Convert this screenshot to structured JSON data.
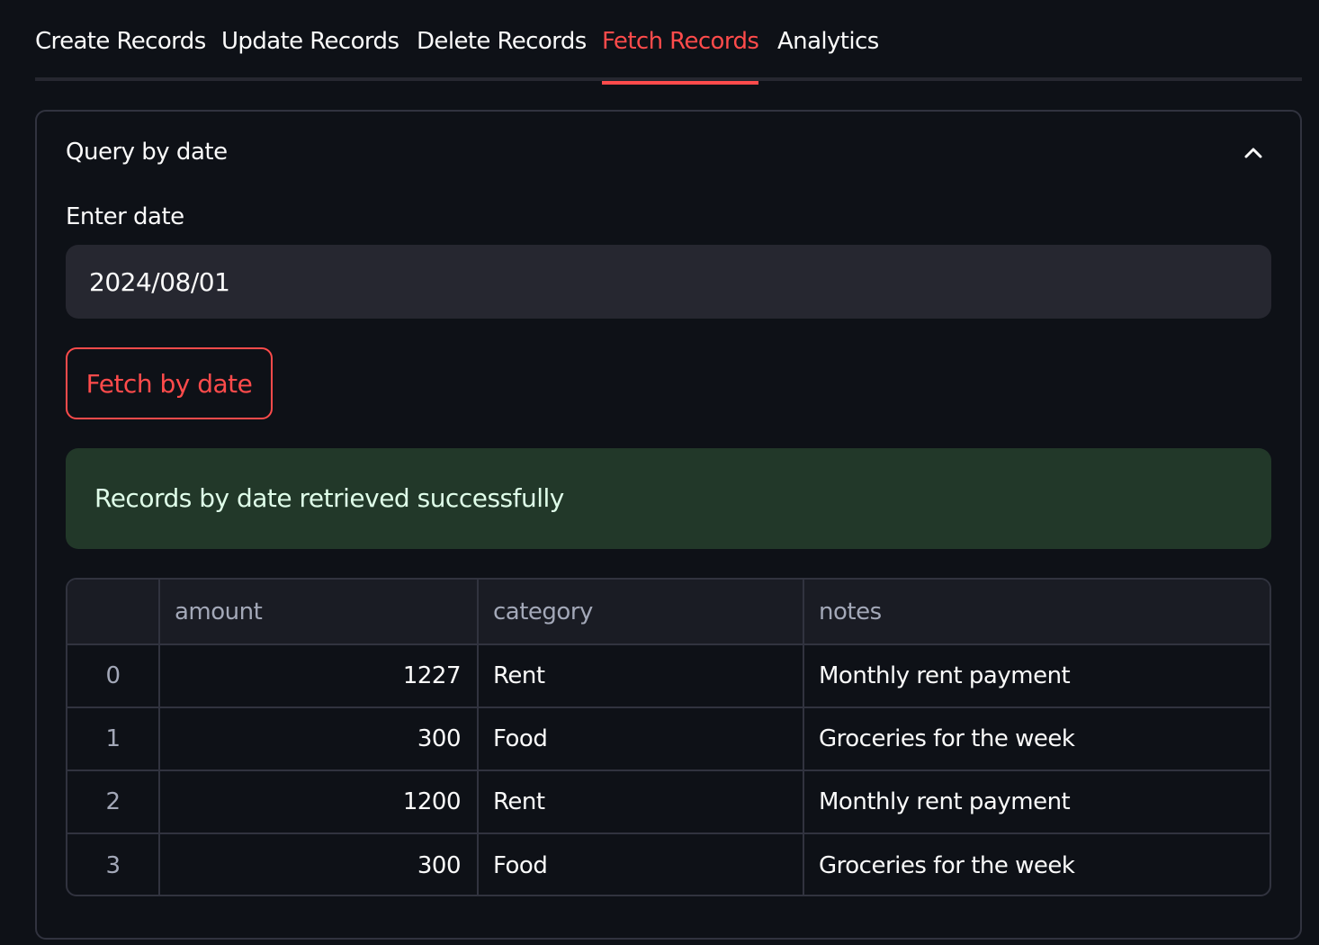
{
  "tabs": [
    {
      "label": "Create Records"
    },
    {
      "label": "Update Records"
    },
    {
      "label": "Delete Records"
    },
    {
      "label": "Fetch Records",
      "active": true
    },
    {
      "label": "Analytics"
    }
  ],
  "expander": {
    "title": "Query by date",
    "icon": "chevron-up-icon"
  },
  "date_field": {
    "label": "Enter date",
    "value": "2024/08/01"
  },
  "fetch_button": {
    "label": "Fetch by date"
  },
  "alert": {
    "message": "Records by date retrieved successfully"
  },
  "table": {
    "columns": [
      "",
      "amount",
      "category",
      "notes"
    ],
    "rows": [
      {
        "index": "0",
        "amount": "1227",
        "category": "Rent",
        "notes": "Monthly rent payment"
      },
      {
        "index": "1",
        "amount": "300",
        "category": "Food",
        "notes": "Groceries for the week"
      },
      {
        "index": "2",
        "amount": "1200",
        "category": "Rent",
        "notes": "Monthly rent payment"
      },
      {
        "index": "3",
        "amount": "300",
        "category": "Food",
        "notes": "Groceries for the week"
      }
    ]
  },
  "colors": {
    "background": "#0e1117",
    "accent": "#ff4b4b",
    "success_bg": "#223829",
    "input_bg": "#262730"
  }
}
